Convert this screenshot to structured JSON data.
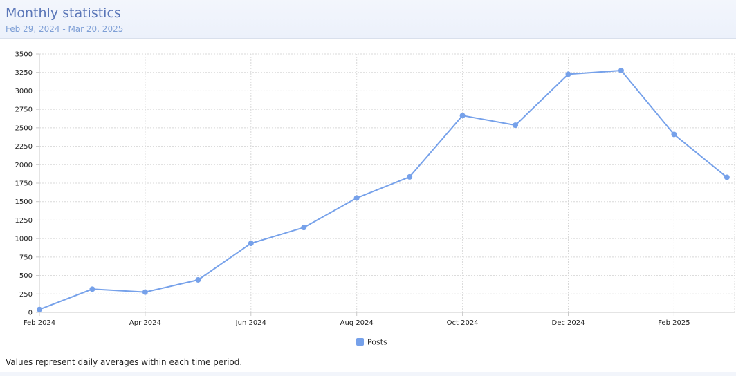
{
  "header": {
    "title": "Monthly statistics",
    "subtitle": "Feb 29, 2024 - Mar 20, 2025"
  },
  "footnote": "Values represent daily averages within each time period.",
  "chart_data": {
    "type": "line",
    "x": [
      "2024-02",
      "2024-03",
      "2024-04",
      "2024-05",
      "2024-06",
      "2024-07",
      "2024-08",
      "2024-09",
      "2024-10",
      "2024-11",
      "2024-12",
      "2025-01",
      "2025-02",
      "2025-03"
    ],
    "x_tick_labels": [
      "Feb 2024",
      "Apr 2024",
      "Jun 2024",
      "Aug 2024",
      "Oct 2024",
      "Dec 2024",
      "Feb 2025"
    ],
    "series": [
      {
        "name": "Posts",
        "color": "#76a1ea",
        "values": [
          40,
          315,
          275,
          440,
          935,
          1150,
          1550,
          1835,
          2665,
          2535,
          3225,
          3275,
          2410,
          1830
        ]
      }
    ],
    "ylim": [
      0,
      3500
    ],
    "y_ticks": [
      0,
      250,
      500,
      750,
      1000,
      1250,
      1500,
      1750,
      2000,
      2250,
      2500,
      2750,
      3000,
      3250,
      3500
    ],
    "grid": true,
    "legend_position": "bottom",
    "title": "",
    "xlabel": "",
    "ylabel": ""
  }
}
